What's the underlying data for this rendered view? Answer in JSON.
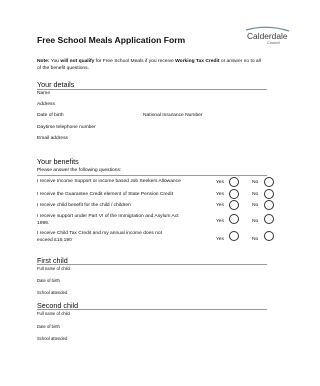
{
  "header": {
    "title": "Free School Meals Application Form",
    "logo_name": "Calderdale",
    "logo_sub": "Council"
  },
  "note": {
    "label": "Note:",
    "pre": " You ",
    "bold1": "will not qualify",
    "mid": " for Free School Meals if you receive ",
    "bold2": "Working Tax Credit",
    "post": " or answer no to all of the benefit questions."
  },
  "details": {
    "heading": "Your details",
    "name": "Name",
    "address": "Address",
    "dob": "Date of birth",
    "ni": "National Insurance Number",
    "phone": "Daytime telephone number",
    "email": "Email address"
  },
  "benefits": {
    "heading": "Your benefits",
    "intro": "Please answer the following questions:",
    "yes": "Yes",
    "no": "No",
    "questions": [
      {
        "line1": "I receive Income Support or income based Job Seekers Allowance",
        "line2": ""
      },
      {
        "line1": "I receive the Guarantee Credit element of State Pension Credit",
        "line2": ""
      },
      {
        "line1": "I receive child benefit for the child / children",
        "line2": ""
      },
      {
        "line1": "I receive support under Part VI of the Immigration and Asylum Act",
        "line2": "1999."
      },
      {
        "line1": "I receive Child Tax Credit and my annual income does not",
        "line2": "exceed £16,190"
      }
    ]
  },
  "first_child": {
    "heading": "First child",
    "full_name": "Full name of child",
    "dob": "Date of birth",
    "school": "School attended"
  },
  "second_child": {
    "heading": "Second child",
    "full_name": "Full name of child",
    "dob": "Date of birth",
    "school": "School attended"
  },
  "colors": {
    "logo_accent": "#6b8fb3",
    "rule": "#9a9a9a"
  }
}
